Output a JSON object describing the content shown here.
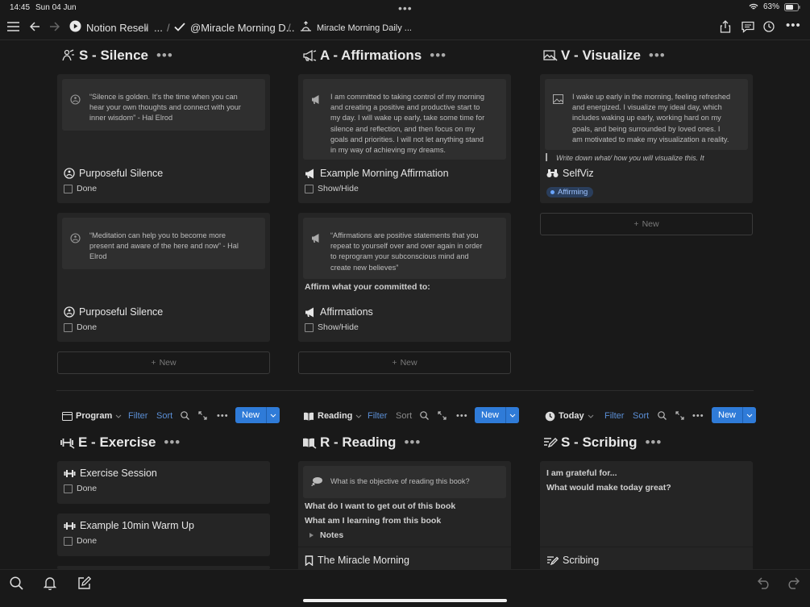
{
  "status_bar": {
    "time": "14:45",
    "date": "Sun 04 Jun",
    "battery": "63%"
  },
  "nav": {
    "breadcrumbs": [
      "Notion Resell",
      "...",
      "@Miracle Morning D...",
      "Miracle Morning Daily ..."
    ]
  },
  "sections_top": [
    {
      "title": "S - Silence",
      "cards": [
        {
          "quote": "“Silence is golden. It’s the time when you can hear your own thoughts and connect with your inner wisdom” - Hal Elrod",
          "title": "Purposeful Silence",
          "check_label": "Done"
        },
        {
          "quote": "“Meditation can help you to become more present and aware of the here and now” - Hal Elrod",
          "title": "Purposeful Silence",
          "check_label": "Done"
        }
      ],
      "new_label": "New"
    },
    {
      "title": "A - Affirmations",
      "cards": [
        {
          "quote": "I am committed to taking control of my morning and creating a positive and productive start to my day. I will wake up early, take some time for silence and reflection, and then focus on my goals and priorities. I will not let anything stand in my way of achieving my dreams.",
          "title": "Example Morning Affirmation",
          "check_label": "Show/Hide"
        },
        {
          "quote": "“Affirmations are positive statements that you repeat to yourself over and over again in order to reprogram your subconscious mind and create new believes”",
          "extra": "Affirm what your committed to:",
          "title": "Affirmations",
          "check_label": "Show/Hide"
        }
      ],
      "new_label": "New"
    },
    {
      "title": "V - Visualize",
      "cards": [
        {
          "quote": "I wake up early in the morning, feeling refreshed and energized. I visualize my ideal day, which includes waking up early, working hard on my goals, and being surrounded by loved ones. I am motivated to make my visualization a reality.",
          "italic": "Write down what/ how you will visualize this. It",
          "title": "SelfViz",
          "tag": "Affirming"
        }
      ],
      "new_label": "New"
    }
  ],
  "toolbars": [
    {
      "view": "Program",
      "filter": "Filter",
      "sort": "Sort",
      "new": "New"
    },
    {
      "view": "Reading",
      "filter": "Filter",
      "sort": "Sort",
      "new": "New"
    },
    {
      "view": "Today",
      "filter": "Filter",
      "sort": "Sort",
      "new": "New"
    }
  ],
  "sections_bottom": {
    "exercise": {
      "title": "E - Exercise",
      "cards": [
        {
          "title": "Exercise Session",
          "check_label": "Done"
        },
        {
          "title": "Example 10min Warm Up",
          "check_label": "Done"
        }
      ]
    },
    "reading": {
      "title": "R - Reading",
      "quote": "What is the objective of reading this book?",
      "line1": "What do I want to get out of this book",
      "line2": "What am I learning from this book",
      "toggle": "Notes",
      "book": "The Miracle Morning"
    },
    "scribing": {
      "title": "S - Scribing",
      "line1": "I am grateful for...",
      "line2": "What would make today great?",
      "card_title": "Scribing"
    }
  },
  "colors": {
    "background": "#191919",
    "card": "#252525",
    "accent": "#2f7bd8",
    "link": "#5b8fd6"
  }
}
